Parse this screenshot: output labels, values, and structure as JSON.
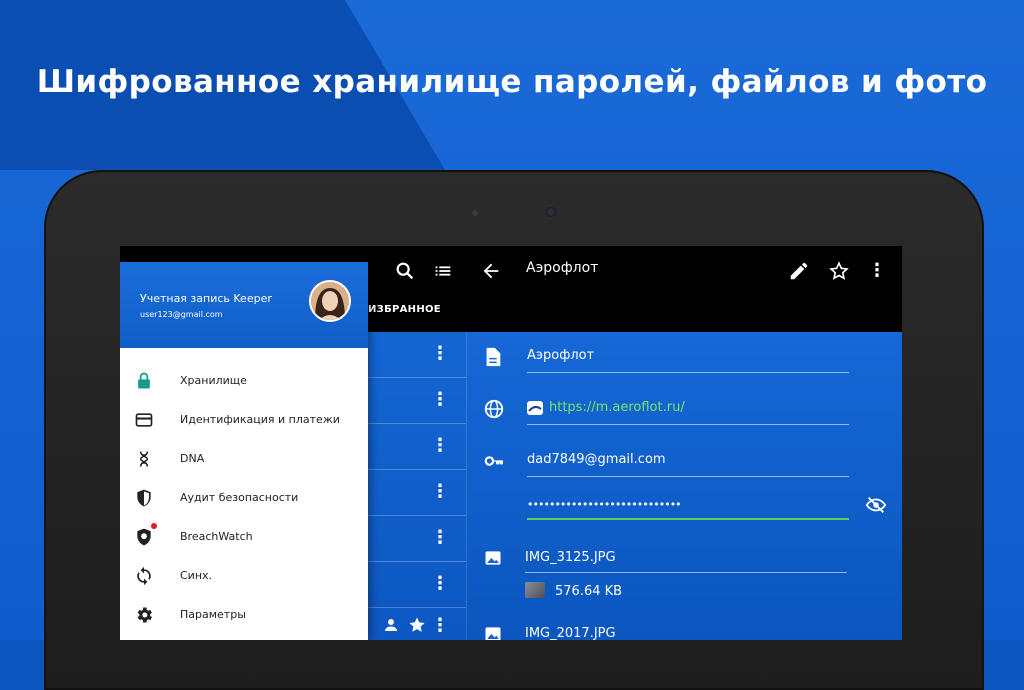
{
  "headline": "Шифрованное хранилище паролей, файлов и фото",
  "colors": {
    "accent_blue": "#0e5fcb",
    "url_green": "#7ee06a",
    "notification_red": "#e0192d"
  },
  "drawer": {
    "account_title": "Учетная запись Keeper",
    "account_email": "user123@gmail.com",
    "items": [
      {
        "label": "Хранилище",
        "icon": "lock-icon"
      },
      {
        "label": "Идентификация и платежи",
        "icon": "credit-card-icon"
      },
      {
        "label": "DNA",
        "icon": "dna-icon"
      },
      {
        "label": "Аудит безопасности",
        "icon": "shield-icon"
      },
      {
        "label": "BreachWatch",
        "icon": "breachwatch-icon"
      },
      {
        "label": "Синх.",
        "icon": "sync-icon"
      },
      {
        "label": "Параметры",
        "icon": "gear-icon"
      }
    ]
  },
  "list_pane": {
    "tab_label": "ИЗБРАННОЕ",
    "toolbar_icons": [
      "search-icon",
      "list-view-icon"
    ]
  },
  "detail": {
    "title": "Аэрофлот",
    "record_name": "Аэрофлот",
    "url": "https://m.aeroflot.ru/",
    "login": "dad7849@gmail.com",
    "password_mask": "••••••••••••••••••••••••••••",
    "file1_name": "IMG_3125.JPG",
    "file1_size": "576.64 KB",
    "file2_name": "IMG_2017.JPG"
  }
}
